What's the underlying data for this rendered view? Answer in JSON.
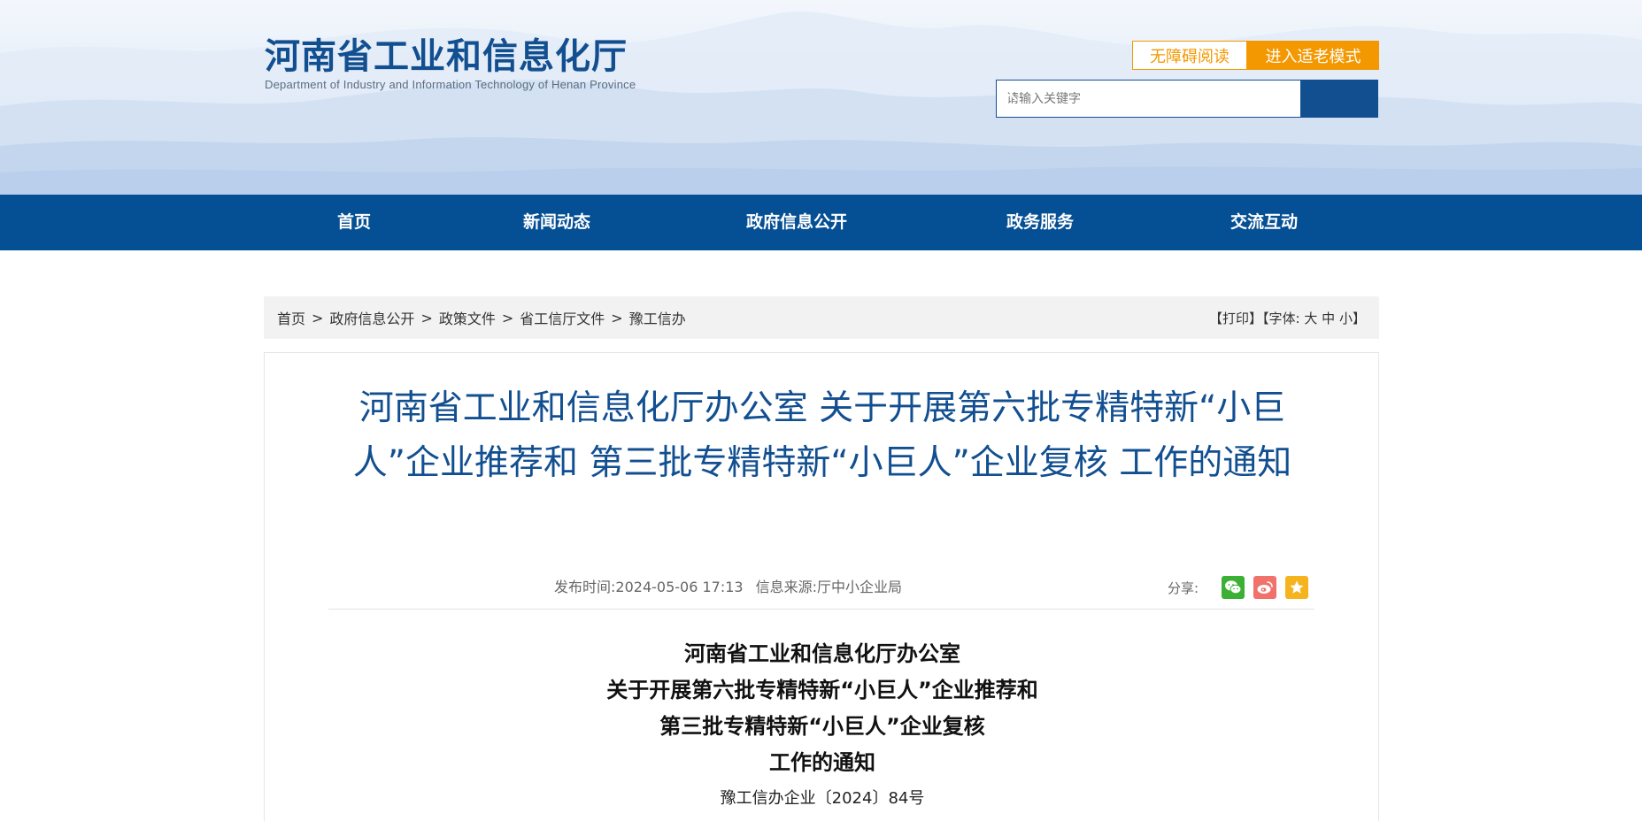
{
  "header": {
    "logo_cn": "河南省工业和信息化厅",
    "logo_en": "Department of Industry and Information Technology of Henan Province",
    "accessible_reading": "无障碍阅读",
    "elder_mode": "进入适老模式",
    "search_placeholder": "请输入关键字",
    "brand_color": "#124f90",
    "accent_color": "#f39800"
  },
  "nav": {
    "items": [
      {
        "label": "首页"
      },
      {
        "label": "新闻动态"
      },
      {
        "label": "政府信息公开"
      },
      {
        "label": "政务服务"
      },
      {
        "label": "交流互动"
      }
    ]
  },
  "breadcrumb": {
    "items": [
      "首页",
      "政府信息公开",
      "政策文件",
      "省工信厅文件",
      "豫工信办"
    ],
    "separator": ">"
  },
  "tools": {
    "print": "【打印】",
    "font_label": "【字体:",
    "large": "大",
    "medium": "中",
    "small": "小",
    "close": "】"
  },
  "article": {
    "title": "河南省工业和信息化厅办公室 关于开展第六批专精特新“小巨人”企业推荐和 第三批专精特新“小巨人”企业复核 工作的通知",
    "publish_label": "发布时间:",
    "publish_time": "2024-05-06 17:13",
    "source_label": "信息来源:",
    "source": "厅中小企业局",
    "share_label": "分享:",
    "share_icons": [
      "wechat-icon",
      "weibo-icon",
      "favorite-icon"
    ],
    "doc_header_lines": [
      "河南省工业和信息化厅办公室",
      "关于开展第六批专精特新“小巨人”企业推荐和",
      "第三批专精特新“小巨人”企业复核",
      "工作的通知"
    ],
    "doc_number": "豫工信办企业〔2024〕84号"
  }
}
